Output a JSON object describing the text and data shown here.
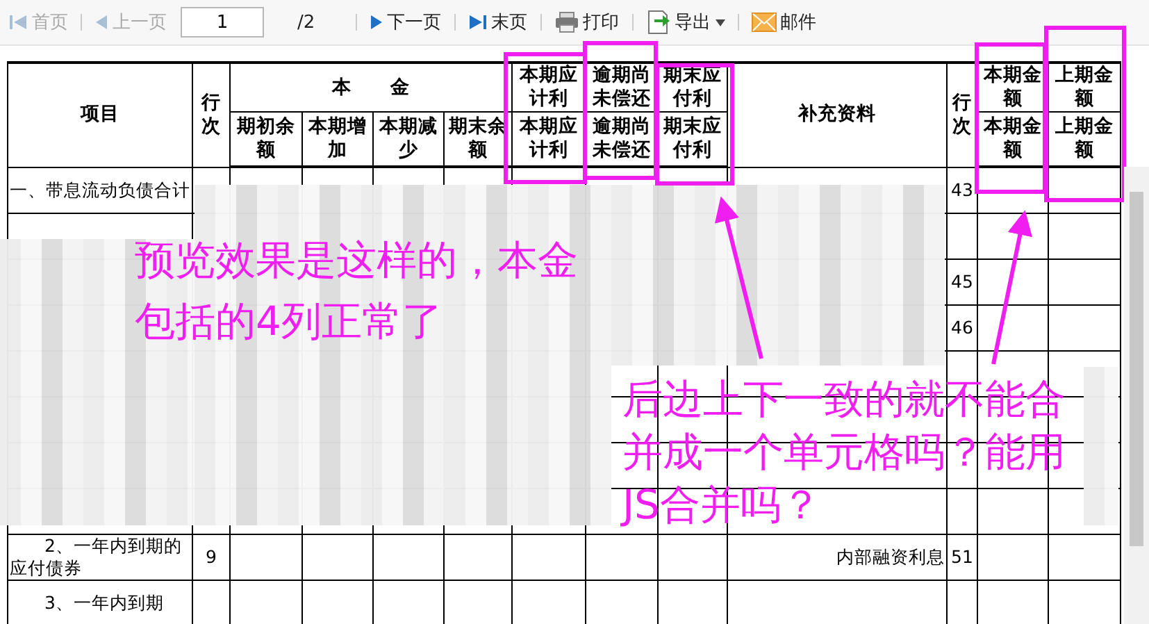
{
  "toolbar": {
    "items": [
      {
        "kind": "first",
        "label": "首页",
        "disabled": true
      },
      {
        "kind": "prev",
        "label": "上一页",
        "disabled": true
      },
      {
        "kind": "page",
        "value": "1"
      },
      {
        "kind": "total",
        "label": "/2"
      },
      {
        "kind": "next",
        "label": "下一页",
        "disabled": false
      },
      {
        "kind": "last",
        "label": "末页",
        "disabled": false
      },
      {
        "kind": "print",
        "label": "打印",
        "disabled": false
      },
      {
        "kind": "export",
        "label": "导出",
        "disabled": false
      },
      {
        "kind": "mail",
        "label": "邮件",
        "disabled": false
      }
    ]
  },
  "table": {
    "header": {
      "item": "项目",
      "line_no": "行次",
      "principal": "本　　金",
      "principal_columns": [
        "期初余额",
        "本期增加",
        "本期减少",
        "期末余额"
      ],
      "interest_columns": [
        {
          "top": "本期应计利",
          "bottom": "本期应计利"
        },
        {
          "top": "逾期尚未偿还",
          "bottom": "逾期尚未偿还"
        },
        {
          "top": "期末应付利",
          "bottom": "期末应付利"
        }
      ],
      "supplement": "补充资料",
      "line_no_2": "行次",
      "amount_columns": [
        {
          "top": "本期金额",
          "bottom": "本期金额"
        },
        {
          "top": "上期金额",
          "bottom": "上期金额"
        }
      ]
    },
    "rows": [
      {
        "kind": "heading",
        "item": "一、带息流动负债合计",
        "line_no": "",
        "supplement": "",
        "line_no_2": "43"
      },
      {
        "kind": "heading",
        "item": "",
        "line_no": "",
        "supplement": "",
        "line_no_2": ""
      },
      {
        "kind": "heading",
        "item": "",
        "line_no": "",
        "supplement": "",
        "line_no_2": "45"
      },
      {
        "kind": "heading",
        "item": "",
        "line_no": "",
        "supplement": "",
        "line_no_2": "46"
      },
      {
        "kind": "heading",
        "item": "",
        "line_no": "",
        "supplement": "",
        "line_no_2": ""
      },
      {
        "kind": "heading",
        "item": "",
        "line_no": "",
        "supplement": "",
        "line_no_2": ""
      },
      {
        "kind": "heading",
        "item": "",
        "line_no": "",
        "supplement": "",
        "line_no_2": ""
      },
      {
        "kind": "heading",
        "item": "",
        "line_no": "",
        "supplement": "",
        "line_no_2": ""
      },
      {
        "kind": "sub",
        "item": "2、一年内到期的应付债券",
        "line_no": "9",
        "supplement": "内部融资利息",
        "line_no_2": "51"
      },
      {
        "kind": "sub",
        "item": "3、一年内到期",
        "line_no": "",
        "supplement": "",
        "line_no_2": ""
      }
    ]
  },
  "annotations": [
    {
      "text": "预览效果是这样的，本金包括的4列正常了"
    },
    {
      "text": "后边上下一致的就不能合并成一个单元格吗？能用JS合并吗？"
    }
  ]
}
